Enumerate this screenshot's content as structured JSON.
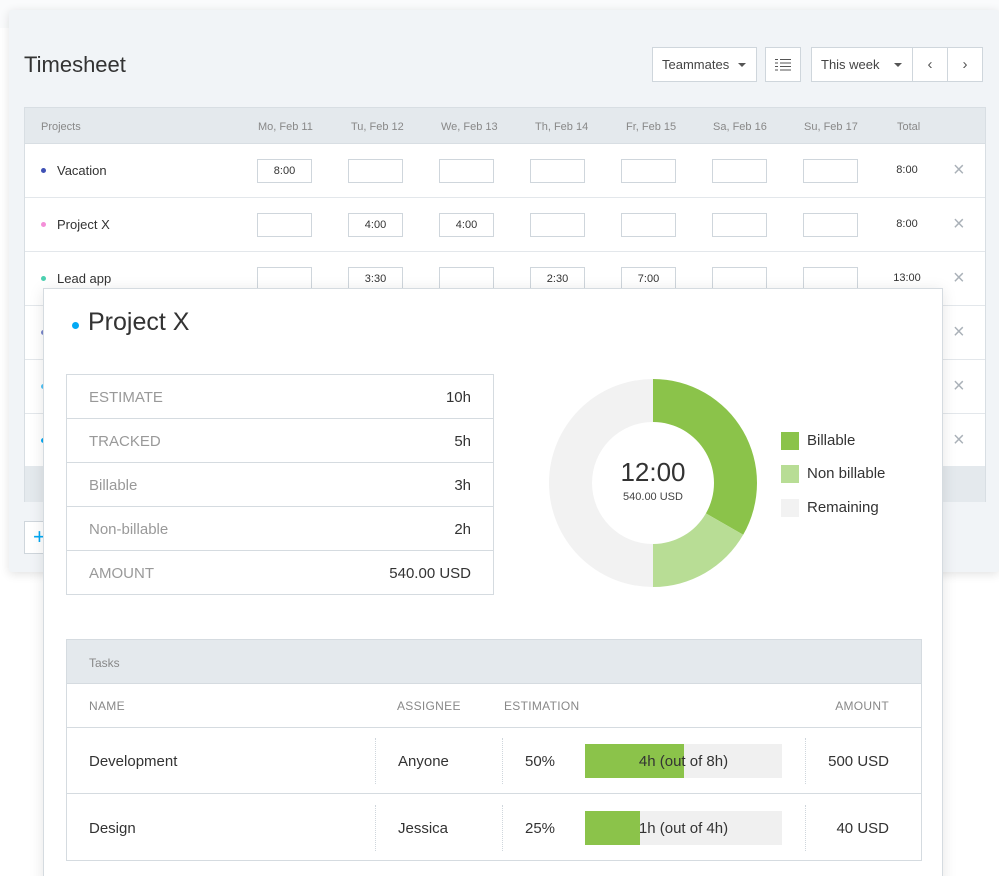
{
  "timesheet": {
    "title": "Timesheet",
    "teammates_label": "Teammates",
    "range_label": "This week",
    "columns": {
      "projects": "Projects",
      "days": [
        "Mo, Feb 11",
        "Tu, Feb 12",
        "We, Feb 13",
        "Th, Feb 14",
        "Fr, Feb 15",
        "Sa, Feb 16",
        "Su, Feb 17"
      ],
      "total": "Total"
    },
    "rows": [
      {
        "name": "Vacation",
        "color": "#3f51b5",
        "cells": [
          "8:00",
          "",
          "",
          "",
          "",
          "",
          ""
        ],
        "total": "8:00"
      },
      {
        "name": "Project X",
        "color": "#f48fd8",
        "cells": [
          "",
          "4:00",
          "4:00",
          "",
          "",
          "",
          ""
        ],
        "total": "8:00"
      },
      {
        "name": "Lead app",
        "color": "#4dd0b0",
        "cells": [
          "",
          "3:30",
          "",
          "2:30",
          "7:00",
          "",
          ""
        ],
        "total": "13:00"
      }
    ],
    "extra_row_dot_colors": [
      "#7986cb",
      "#4fc3f7",
      "#03a9f4"
    ],
    "icons": {
      "list_view": "list-icon",
      "prev": "chevron-left-icon",
      "next": "chevron-right-icon",
      "remove": "close-icon",
      "add": "plus-icon"
    }
  },
  "project_panel": {
    "title": "Project X",
    "title_dot_color": "#03a9f4",
    "stats": [
      {
        "label": "ESTIMATE",
        "value": "10h"
      },
      {
        "label": "TRACKED",
        "value": "5h"
      },
      {
        "label": "Billable",
        "value": "3h"
      },
      {
        "label": "Non-billable",
        "value": "2h"
      },
      {
        "label": "AMOUNT",
        "value": "540.00 USD"
      }
    ],
    "donut": {
      "center_time": "12:00",
      "center_amount": "540.00 USD",
      "segments": [
        {
          "label": "Billable",
          "fraction": 0.333,
          "color": "#8bc34a"
        },
        {
          "label": "Non billable",
          "fraction": 0.167,
          "color": "#b8dd95"
        },
        {
          "label": "Remaining",
          "fraction": 0.5,
          "color": "#f2f2f2"
        }
      ]
    },
    "tasks": {
      "title": "Tasks",
      "columns": {
        "name": "NAME",
        "assignee": "ASSIGNEE",
        "estimation": "ESTIMATION",
        "amount": "AMOUNT"
      },
      "rows": [
        {
          "name": "Development",
          "assignee": "Anyone",
          "percent": "50%",
          "progress": 0.5,
          "bar_text": "4h (out of 8h)",
          "amount": "500 USD"
        },
        {
          "name": "Design",
          "assignee": "Jessica",
          "percent": "25%",
          "progress": 0.28,
          "bar_text": "1h (out of 4h)",
          "amount": "40 USD"
        }
      ]
    }
  }
}
